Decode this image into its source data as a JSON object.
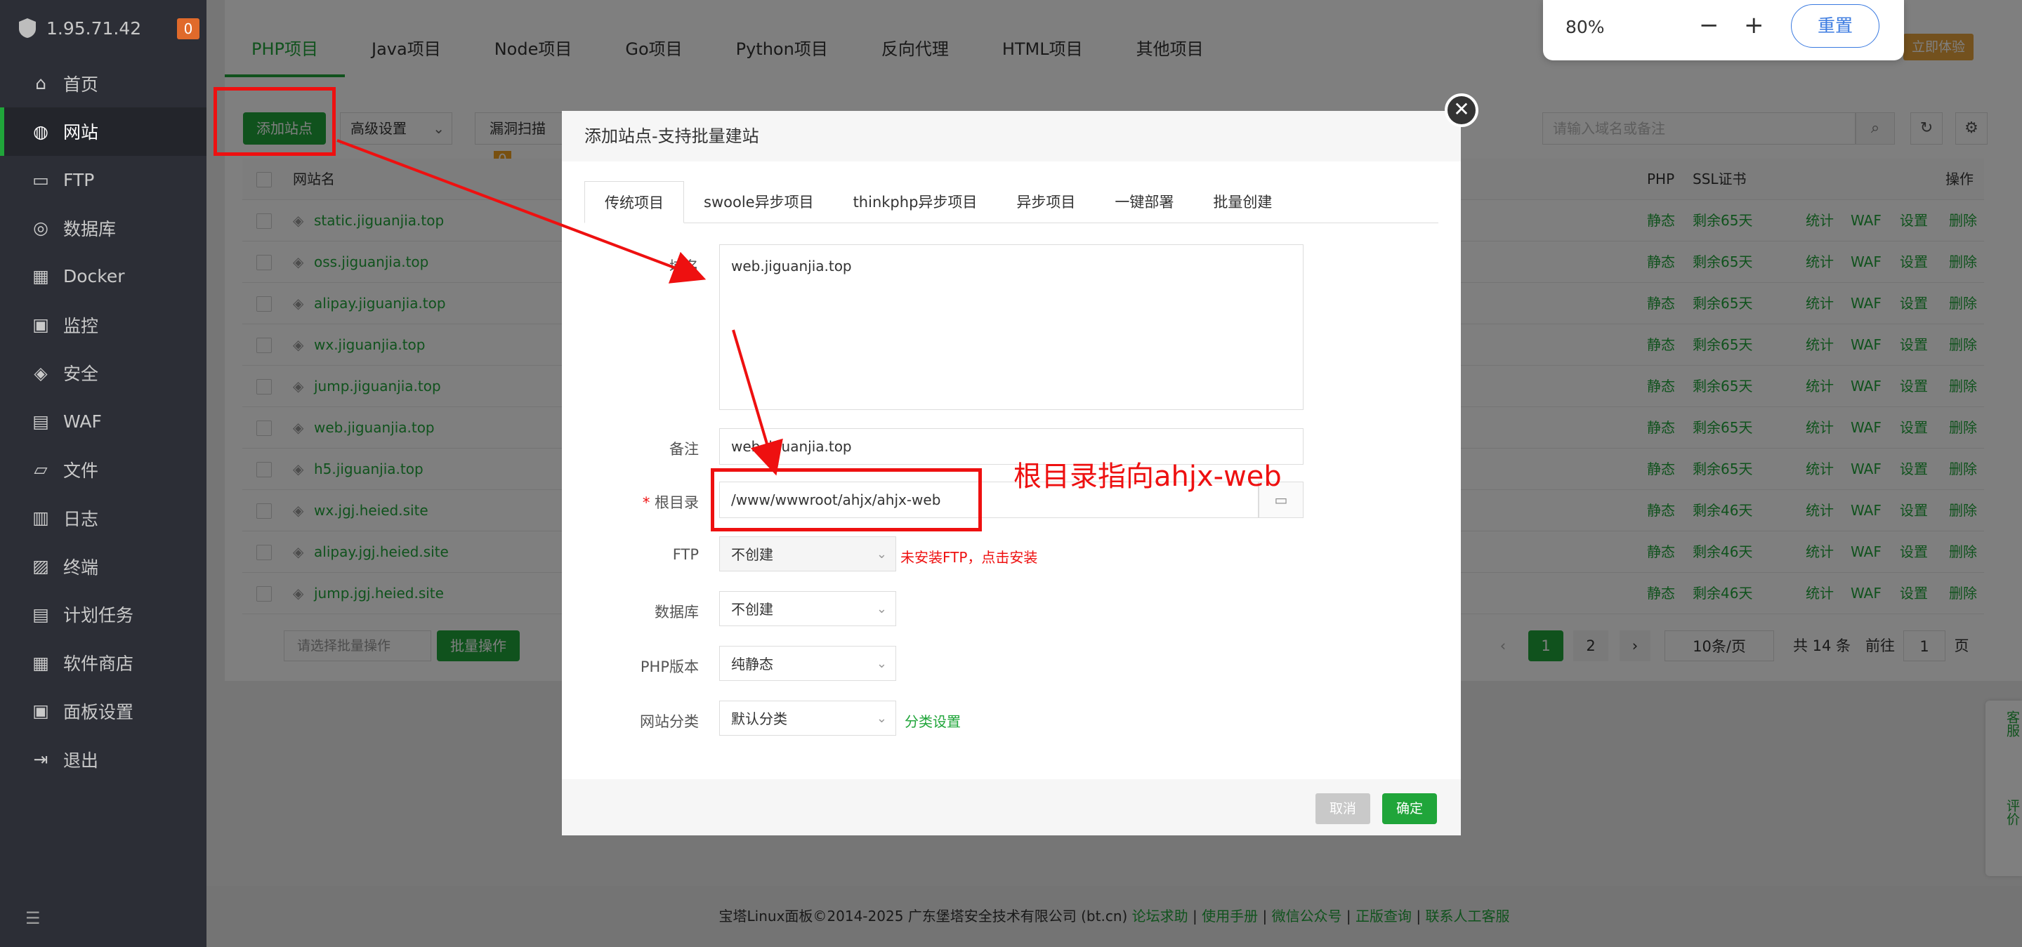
{
  "sidebar": {
    "ip": "1.95.71.42",
    "badge": "0",
    "items": [
      {
        "label": "首页",
        "icon": "home-icon"
      },
      {
        "label": "网站",
        "icon": "globe-icon"
      },
      {
        "label": "FTP",
        "icon": "ftp-icon"
      },
      {
        "label": "数据库",
        "icon": "database-icon"
      },
      {
        "label": "Docker",
        "icon": "docker-icon"
      },
      {
        "label": "监控",
        "icon": "monitor-icon"
      },
      {
        "label": "安全",
        "icon": "shield-icon"
      },
      {
        "label": "WAF",
        "icon": "waf-icon"
      },
      {
        "label": "文件",
        "icon": "folder-icon"
      },
      {
        "label": "日志",
        "icon": "log-icon"
      },
      {
        "label": "终端",
        "icon": "terminal-icon"
      },
      {
        "label": "计划任务",
        "icon": "schedule-icon"
      },
      {
        "label": "软件商店",
        "icon": "store-icon"
      },
      {
        "label": "面板设置",
        "icon": "settings-icon"
      },
      {
        "label": "退出",
        "icon": "logout-icon"
      }
    ]
  },
  "top_tabs": [
    "PHP项目",
    "Java项目",
    "Node项目",
    "Go项目",
    "Python项目",
    "反向代理",
    "HTML项目",
    "其他项目"
  ],
  "toolbar": {
    "add_site": "添加站点",
    "advanced": "高级设置",
    "vuln_scan": "漏洞扫描",
    "vuln_count": "0",
    "search_placeholder": "请输入域名或备注",
    "try_now": "立即体验"
  },
  "table": {
    "headers": {
      "name": "网站名",
      "php": "PHP",
      "ssl": "SSL证书",
      "ops": "操作"
    },
    "rows": [
      {
        "name": "static.jiguanjia.top",
        "php": "静态",
        "ssl": "剩余65天"
      },
      {
        "name": "oss.jiguanjia.top",
        "php": "静态",
        "ssl": "剩余65天"
      },
      {
        "name": "alipay.jiguanjia.top",
        "php": "静态",
        "ssl": "剩余65天"
      },
      {
        "name": "wx.jiguanjia.top",
        "php": "静态",
        "ssl": "剩余65天"
      },
      {
        "name": "jump.jiguanjia.top",
        "php": "静态",
        "ssl": "剩余65天"
      },
      {
        "name": "web.jiguanjia.top",
        "php": "静态",
        "ssl": "剩余65天"
      },
      {
        "name": "h5.jiguanjia.top",
        "php": "静态",
        "ssl": "剩余65天"
      },
      {
        "name": "wx.jgj.heied.site",
        "php": "静态",
        "ssl": "剩余46天"
      },
      {
        "name": "alipay.jgj.heied.site",
        "php": "静态",
        "ssl": "剩余46天"
      },
      {
        "name": "jump.jgj.heied.site",
        "php": "静态",
        "ssl": "剩余46天"
      }
    ],
    "ops": [
      "统计",
      "WAF",
      "设置",
      "删除"
    ]
  },
  "bottom": {
    "batch_select": "请选择批量操作",
    "batch_btn": "批量操作",
    "page1": "1",
    "page2": "2",
    "per_page": "10条/页",
    "total": "共 14 条",
    "goto": "前往",
    "goto_val": "1",
    "page_unit": "页"
  },
  "zoom": {
    "level": "80%",
    "minus": "−",
    "plus": "+",
    "reset": "重置"
  },
  "modal": {
    "title": "添加站点-支持批量建站",
    "tabs": [
      "传统项目",
      "swoole异步项目",
      "thinkphp异步项目",
      "异步项目",
      "一键部署",
      "批量创建"
    ],
    "domain_label": "域名",
    "domain_value": "web.jiguanjia.top",
    "note_label": "备注",
    "note_value": "web.jiguanjia.top",
    "root_label": "根目录",
    "root_required": "*",
    "root_value": "/www/wwwroot/ahjx/ahjx-web",
    "ftp_label": "FTP",
    "ftp_value": "不创建",
    "ftp_hint": "未安装FTP，点击安装",
    "db_label": "数据库",
    "db_value": "不创建",
    "php_label": "PHP版本",
    "php_value": "纯静态",
    "cat_label": "网站分类",
    "cat_value": "默认分类",
    "cat_link": "分类设置",
    "cancel": "取消",
    "confirm": "确定"
  },
  "annotation": {
    "text": "根目录指向ahjx-web",
    "color": "#ee1010"
  },
  "footer": {
    "copyright": "宝塔Linux面板©2014-2025 广东堡塔安全技术有限公司 (bt.cn)",
    "links": [
      "论坛求助",
      "使用手册",
      "微信公众号",
      "正版查询",
      "联系人工客服"
    ]
  },
  "float": {
    "service": "客服",
    "rate": "评价"
  }
}
